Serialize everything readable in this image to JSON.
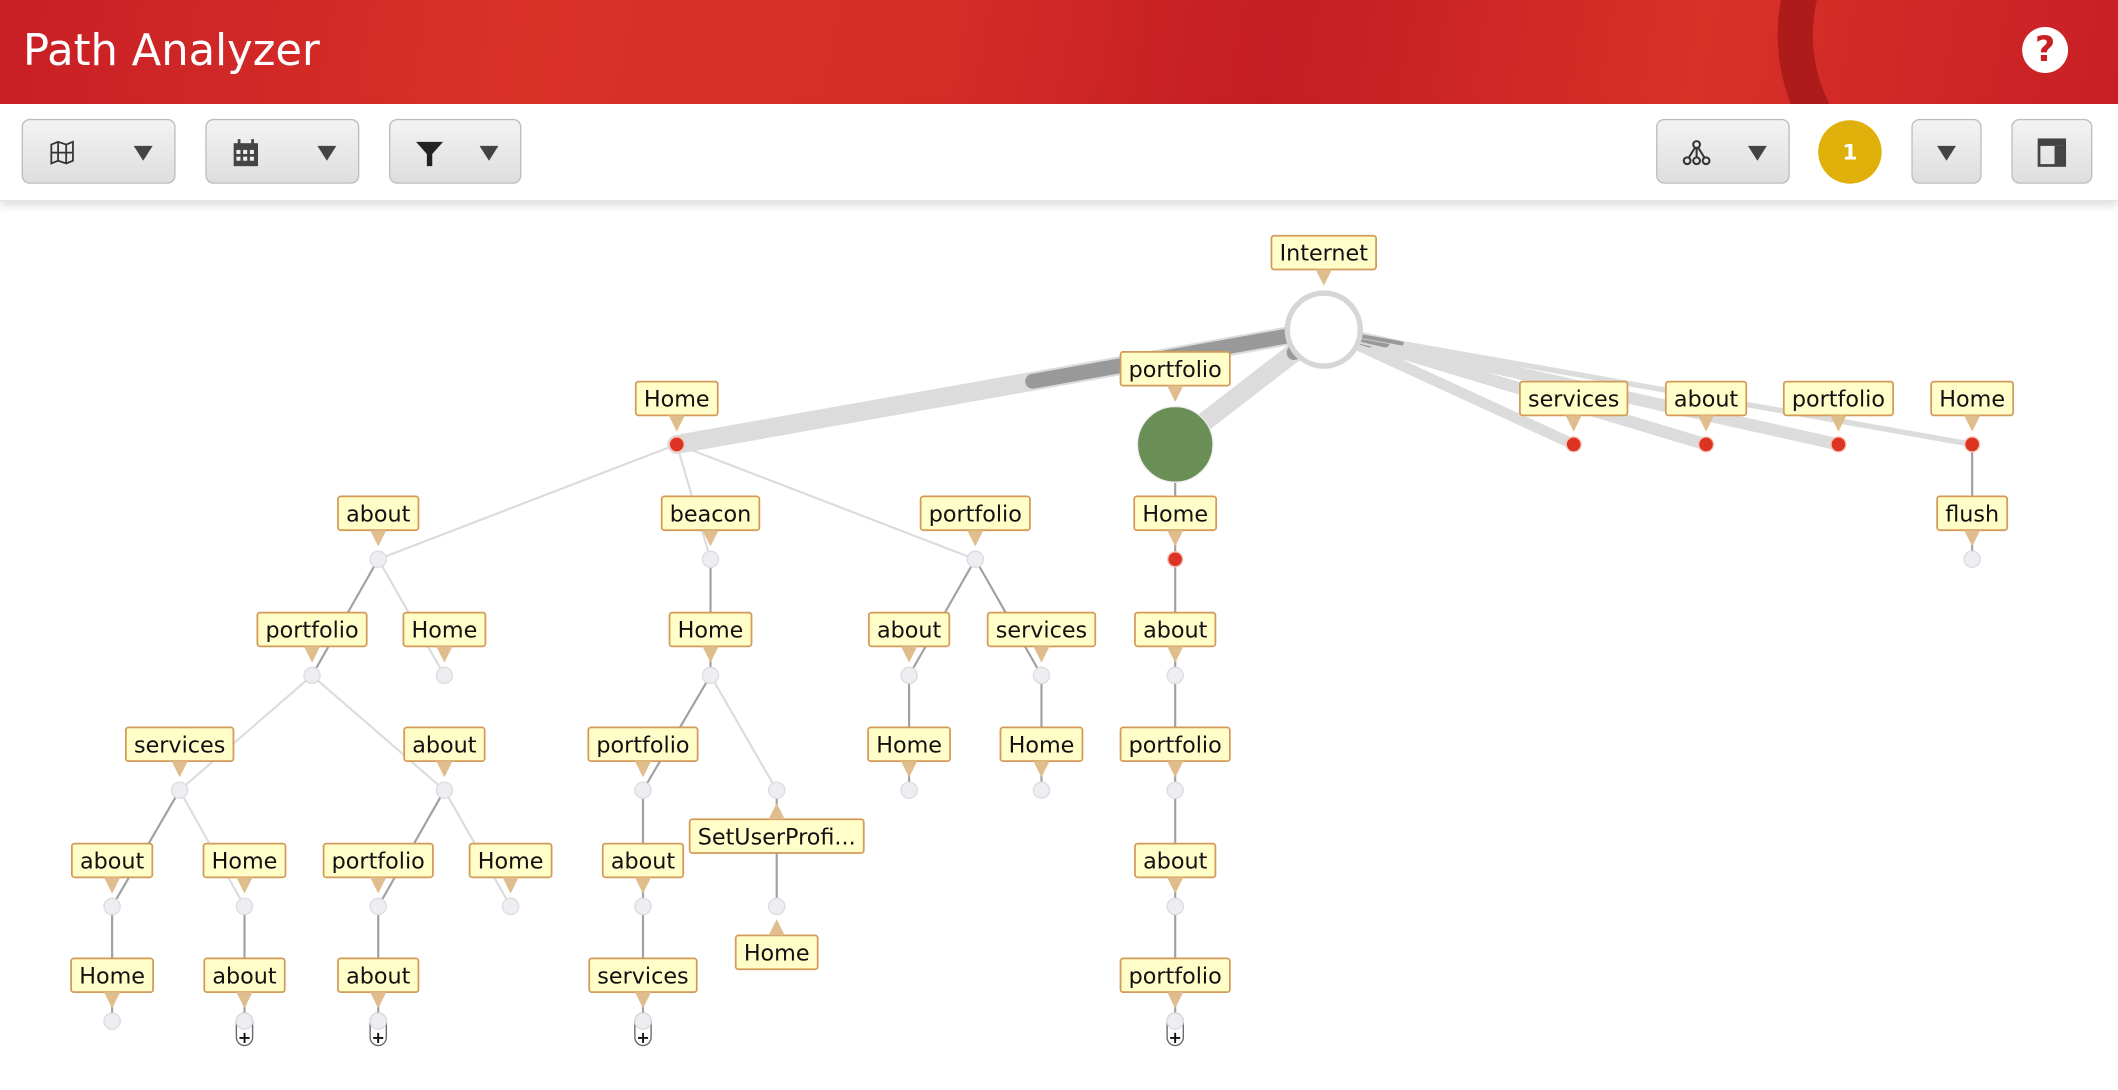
{
  "header": {
    "title": "Path Analyzer",
    "help_icon": "question-circle-icon"
  },
  "toolbar": {
    "buttons": [
      {
        "name": "map-dropdown",
        "icon": "map-icon"
      },
      {
        "name": "date-dropdown",
        "icon": "calendar-icon"
      },
      {
        "name": "filter-dropdown",
        "icon": "funnel-icon"
      },
      {
        "name": "tree-layout-dropdown",
        "icon": "hierarchy-icon"
      },
      {
        "name": "options-dropdown",
        "icon": "chevron-down-icon"
      },
      {
        "name": "panel-toggle",
        "icon": "layout-panel-icon"
      }
    ],
    "badge_count": "1",
    "badge_color": "#e0b00a"
  },
  "colors": {
    "header": "#c81f25",
    "node_red": "#dd3322",
    "node_green": "#6a8f56",
    "label_bg": "#fffdc8",
    "label_border": "#d49a58"
  },
  "tree": {
    "nodes": [
      {
        "label": "Internet",
        "parent": null,
        "kind": "root"
      },
      {
        "label": "Home",
        "parent": 0,
        "kind": "red"
      },
      {
        "label": "portfolio",
        "parent": 0,
        "kind": "green"
      },
      {
        "label": "services",
        "parent": 0,
        "kind": "red"
      },
      {
        "label": "about",
        "parent": 0,
        "kind": "red"
      },
      {
        "label": "portfolio",
        "parent": 0,
        "kind": "red"
      },
      {
        "label": "Home",
        "parent": 0,
        "kind": "red"
      },
      {
        "label": "flush",
        "parent": 6,
        "kind": "plain"
      },
      {
        "label": "about",
        "parent": 1,
        "kind": "plain"
      },
      {
        "label": "beacon",
        "parent": 1,
        "kind": "plain"
      },
      {
        "label": "portfolio",
        "parent": 1,
        "kind": "plain"
      },
      {
        "label": "portfolio",
        "parent": 8,
        "kind": "plain"
      },
      {
        "label": "Home",
        "parent": 8,
        "kind": "plain"
      },
      {
        "label": "services",
        "parent": 11,
        "kind": "plain"
      },
      {
        "label": "about",
        "parent": 11,
        "kind": "plain"
      },
      {
        "label": "about",
        "parent": 13,
        "kind": "plain"
      },
      {
        "label": "Home",
        "parent": 13,
        "kind": "plain"
      },
      {
        "label": "portfolio",
        "parent": 14,
        "kind": "plain"
      },
      {
        "label": "Home",
        "parent": 14,
        "kind": "plain"
      },
      {
        "label": "Home",
        "parent": 15,
        "kind": "plain"
      },
      {
        "label": "about",
        "parent": 16,
        "kind": "expand"
      },
      {
        "label": "about",
        "parent": 17,
        "kind": "expand"
      },
      {
        "label": "Home",
        "parent": 9,
        "kind": "plain"
      },
      {
        "label": "portfolio",
        "parent": 22,
        "kind": "plain"
      },
      {
        "label": "SetUserProfi...",
        "parent": 22,
        "kind": "plain"
      },
      {
        "label": "about",
        "parent": 23,
        "kind": "plain"
      },
      {
        "label": "services",
        "parent": 25,
        "kind": "expand"
      },
      {
        "label": "Home",
        "parent": 24,
        "kind": "plain"
      },
      {
        "label": "about",
        "parent": 10,
        "kind": "plain"
      },
      {
        "label": "services",
        "parent": 10,
        "kind": "plain"
      },
      {
        "label": "Home",
        "parent": 28,
        "kind": "plain"
      },
      {
        "label": "Home",
        "parent": 29,
        "kind": "plain"
      },
      {
        "label": "Home",
        "parent": 2,
        "kind": "red"
      },
      {
        "label": "about",
        "parent": 32,
        "kind": "plain"
      },
      {
        "label": "portfolio",
        "parent": 33,
        "kind": "plain"
      },
      {
        "label": "about",
        "parent": 34,
        "kind": "plain"
      },
      {
        "label": "portfolio",
        "parent": 35,
        "kind": "expand"
      }
    ]
  }
}
